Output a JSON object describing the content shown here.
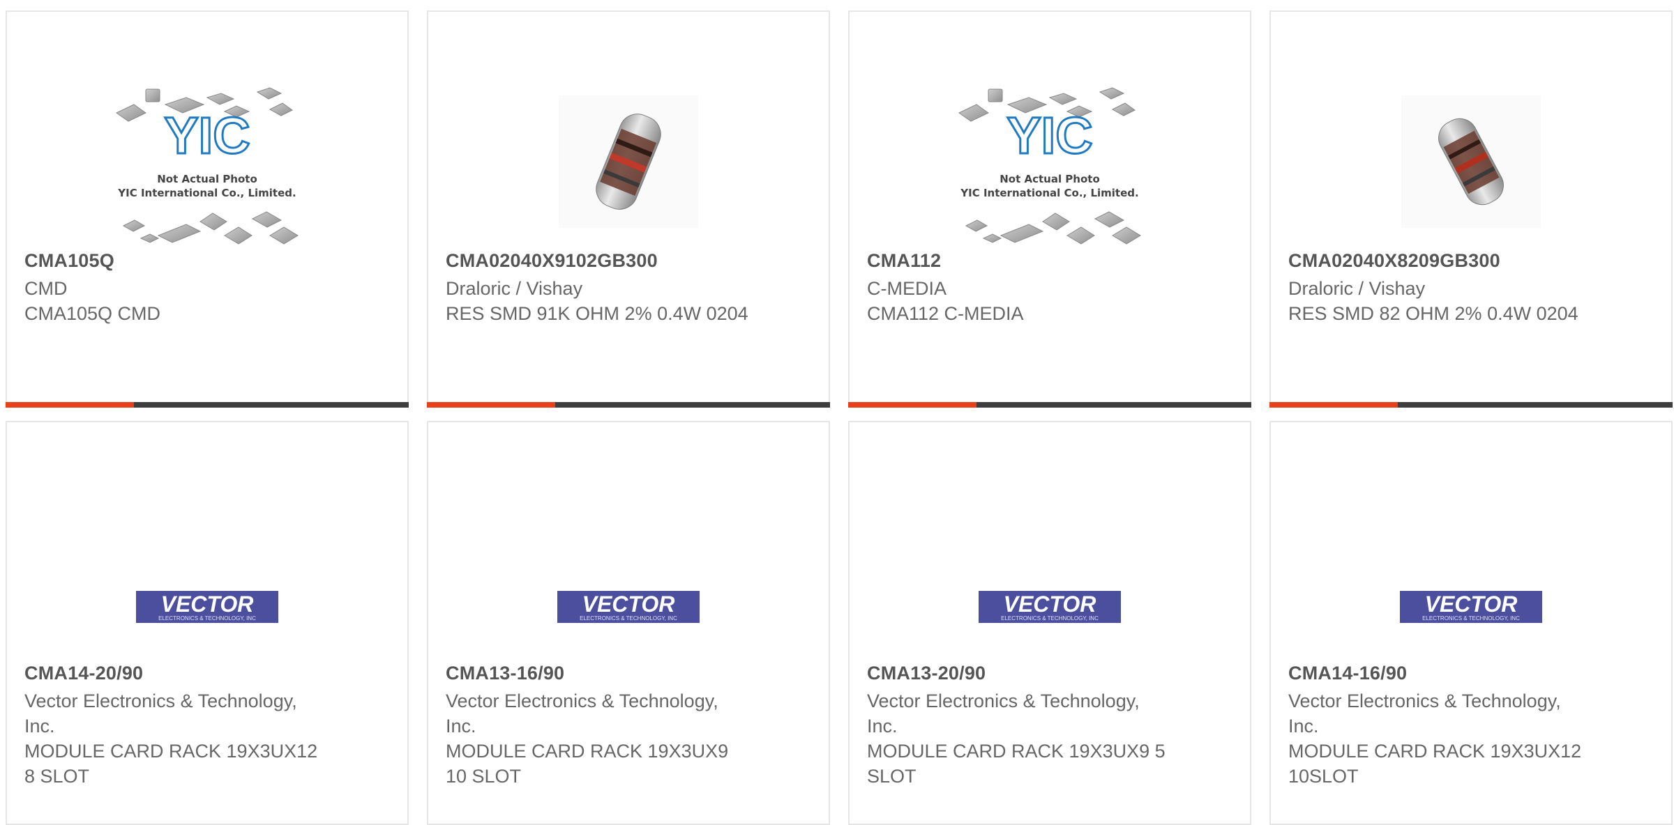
{
  "products": [
    {
      "part": "CMA105Q",
      "manufacturer": "CMD",
      "description": "CMA105Q CMD",
      "image": "yic-placeholder"
    },
    {
      "part": "CMA02040X9102GB300",
      "manufacturer": "Draloric / Vishay",
      "description": "RES SMD 91K OHM 2% 0.4W 0204",
      "image": "resistor-photo"
    },
    {
      "part": "CMA112",
      "manufacturer": "C-MEDIA",
      "description": "CMA112 C-MEDIA",
      "image": "yic-placeholder"
    },
    {
      "part": "CMA02040X8209GB300",
      "manufacturer": "Draloric / Vishay",
      "description": "RES SMD 82 OHM 2% 0.4W 0204",
      "image": "resistor-photo"
    },
    {
      "part": "CMA14-20/90",
      "manufacturer": "Vector Electronics & Technology, Inc.",
      "description": "MODULE CARD RACK 19X3UX12 8 SLOT",
      "image": "vector-logo"
    },
    {
      "part": "CMA13-16/90",
      "manufacturer": "Vector Electronics & Technology, Inc.",
      "description": "MODULE CARD RACK 19X3UX9 10 SLOT",
      "image": "vector-logo"
    },
    {
      "part": "CMA13-20/90",
      "manufacturer": "Vector Electronics & Technology, Inc.",
      "description": "MODULE CARD RACK 19X3UX9 5 SLOT",
      "image": "vector-logo"
    },
    {
      "part": "CMA14-16/90",
      "manufacturer": "Vector Electronics & Technology, Inc.",
      "description": "MODULE CARD RACK 19X3UX12 10SLOT",
      "image": "vector-logo"
    }
  ],
  "placeholder_logo": {
    "brand": "YIC",
    "line1": "Not Actual Photo",
    "line2": "YIC International Co., Limited."
  },
  "vector_logo": {
    "brand": "VECTOR",
    "tagline": "ELECTRONICS & TECHNOLOGY, INC"
  },
  "colors": {
    "accent": "#e8401b",
    "bar": "#3e3e3e",
    "title": "#555555",
    "text": "#666666",
    "vector_blue": "#4b4f9e",
    "yic_blue": "#1f7ac3"
  }
}
